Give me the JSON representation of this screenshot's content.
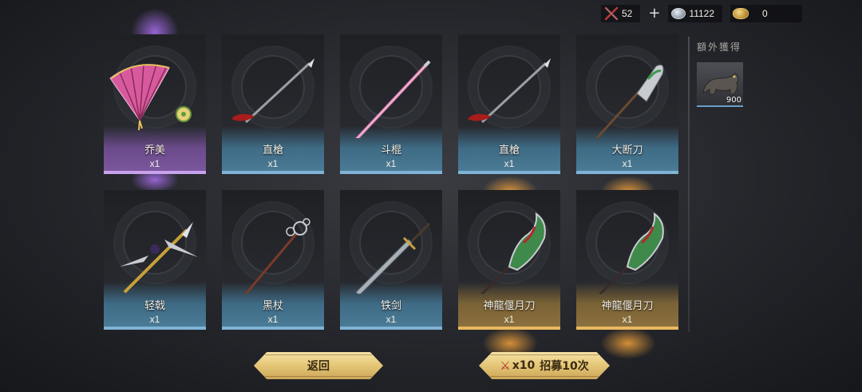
{
  "resources": {
    "crossed_swords": "52",
    "silver": "11122",
    "gold": "0"
  },
  "side": {
    "title": "額外獲得",
    "bonus_qty": "900"
  },
  "cards": [
    {
      "name": "乔美",
      "qty": "x1",
      "rarity": "purple",
      "icon": "folding-fan-icon"
    },
    {
      "name": "直槍",
      "qty": "x1",
      "rarity": "blue",
      "icon": "spear-icon"
    },
    {
      "name": "斗棍",
      "qty": "x1",
      "rarity": "blue",
      "icon": "staff-icon"
    },
    {
      "name": "直槍",
      "qty": "x1",
      "rarity": "blue",
      "icon": "spear-icon"
    },
    {
      "name": "大断刀",
      "qty": "x1",
      "rarity": "blue",
      "icon": "glaive-icon"
    },
    {
      "name": "轻戟",
      "qty": "x1",
      "rarity": "blue",
      "icon": "halberd-icon"
    },
    {
      "name": "黑杖",
      "qty": "x1",
      "rarity": "blue",
      "icon": "staff-icon"
    },
    {
      "name": "铁剑",
      "qty": "x1",
      "rarity": "blue",
      "icon": "sword-icon"
    },
    {
      "name": "神龍偃月刀",
      "qty": "x1",
      "rarity": "gold",
      "icon": "dragon-glaive-icon"
    },
    {
      "name": "神龍偃月刀",
      "qty": "x1",
      "rarity": "gold",
      "icon": "dragon-glaive-icon"
    }
  ],
  "buttons": {
    "back": "返回",
    "recruit_cost": "x10",
    "recruit": "招募10次"
  },
  "colors": {
    "blue_edge": "#7fb4d6",
    "purple_edge": "#c9a2ee",
    "gold_edge": "#e9b860",
    "button_gold": "#e4c676"
  }
}
